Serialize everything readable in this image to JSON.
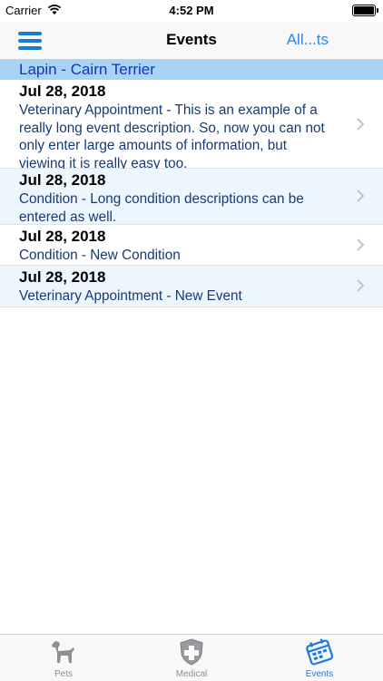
{
  "status": {
    "carrier": "Carrier",
    "time": "4:52 PM"
  },
  "nav": {
    "title": "Events",
    "right_label": "All...ts"
  },
  "section": {
    "title": "Lapin - Cairn Terrier"
  },
  "events": [
    {
      "date": "Jul 28, 2018",
      "description": "Veterinary Appointment - This is an example of a really long event description. So, now you can not only enter large amounts of information, but viewing it is really easy too."
    },
    {
      "date": "Jul 28, 2018",
      "description": "Condition - Long condition descriptions can be entered as well."
    },
    {
      "date": "Jul 28, 2018",
      "description": "Condition - New Condition"
    },
    {
      "date": "Jul 28, 2018",
      "description": "Veterinary Appointment - New Event"
    }
  ],
  "tabs": [
    {
      "label": "Pets",
      "icon": "dog-icon",
      "active": false
    },
    {
      "label": "Medical",
      "icon": "medical-shield-icon",
      "active": false
    },
    {
      "label": "Events",
      "icon": "calendar-icon",
      "active": true
    }
  ],
  "colors": {
    "accent": "#1b7ae0",
    "section_bg": "#a9d3f5",
    "section_text": "#1432c8",
    "desc_text": "#163a78"
  }
}
